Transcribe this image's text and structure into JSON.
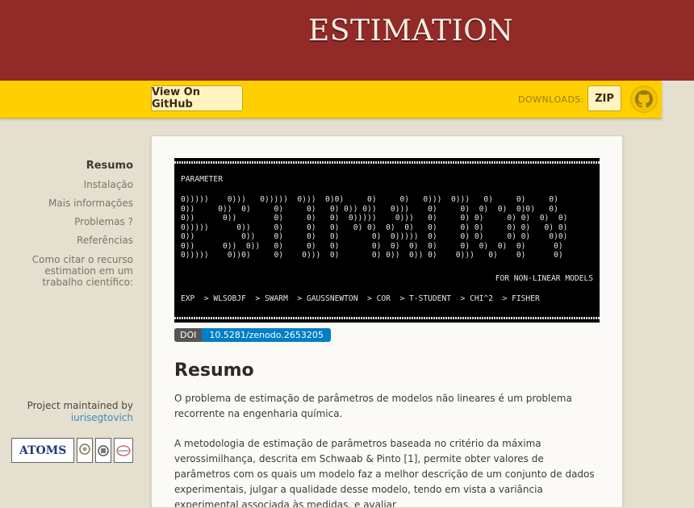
{
  "header": {
    "title": "ESTIMATION"
  },
  "toolbar": {
    "github_label": "View On GitHub",
    "downloads_label": "DOWNLOADS:",
    "zip_label": "ZIP",
    "octocat_icon": "github-octocat-icon"
  },
  "sidebar": {
    "items": [
      {
        "label": "Resumo"
      },
      {
        "label": "Instalação"
      },
      {
        "label": "Mais informações"
      },
      {
        "label": "Problemas ?"
      },
      {
        "label": "Referências"
      },
      {
        "label": "Como citar o recurso estimation em um trabalho científico:"
      }
    ],
    "maintained_label": "Project maintained by",
    "maintainer": "iurisegtovich",
    "logo_text": "ATOMS"
  },
  "banner": {
    "heading": "PARAMETER",
    "art": "0)))))    0)))   0)))))  0)))  0)0)     0)     0)   0)))  0)))   0)     0)     0)\n0))     0))  0)     0)     0)   0) 0)) 0))   0)))    0)     0)  0)  0)  0)0)   0)\n0))      0))        0)     0)   0)  0)))))    0)))   0)     0) 0)     0) 0)  0)  0)\n0)))))      0))     0)     0)   0)   0) 0)  0)  0)   0)     0) 0)     0) 0)   0) 0)\n0))          0))    0)     0)   0)       0)  0)))))  0)     0) 0)     0) 0)    0)0)\n0))      0))  0))   0)     0)   0)       0)  0)  0)  0)     0)  0)  0)  0)      0)\n0)))))    0))0)     0)    0)))  0)       0) 0))  0)) 0)    0)))   0)    0)      0)",
    "subtitle": "FOR NON-LINEAR MODELS",
    "steps": "EXP  > WLSOBJF  > SWARM  > GAUSSNEWTON  > COR  > T-STUDENT  > CHI^2  > FISHER"
  },
  "doi": {
    "key": "DOI",
    "value": "10.5281/zenodo.2653205"
  },
  "main": {
    "heading": "Resumo",
    "paragraphs": [
      "O problema de estimação de parâmetros de modelos não lineares é um problema recorrente na engenharia química.",
      "A metodologia de estimação de parâmetros baseada no critério da máxima verossimilhança, descrita em Schwaab & Pinto [1], permite obter valores de parâmetros com os quais um modelo faz a melhor descrição de um conjunto de dados experimentais, julgar a qualidade desse modelo, tendo em vista a variância experimental associada às medidas, e avaliar"
    ]
  },
  "colors": {
    "header": "#922a28",
    "bar": "#ffcf00",
    "background": "#e4dfcf",
    "link": "#3b8bbd"
  }
}
